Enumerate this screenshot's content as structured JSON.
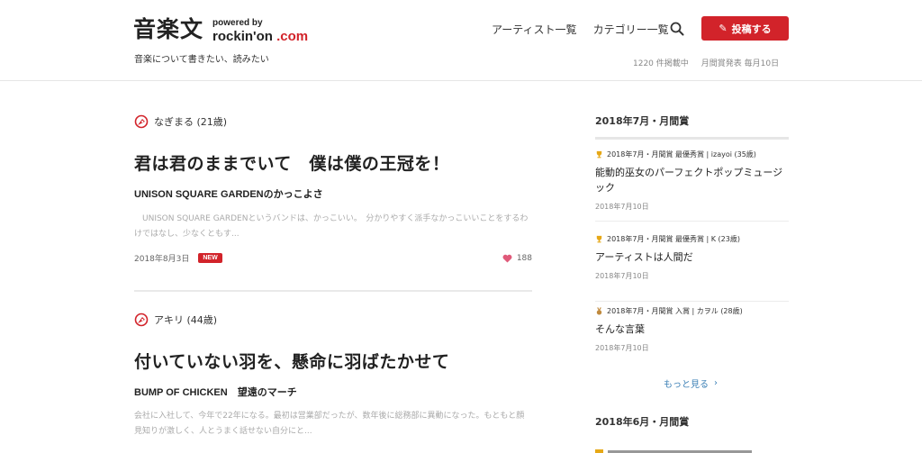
{
  "header": {
    "logo_main": "音楽文",
    "powered_by": "powered by",
    "rockinon": "rockin'on",
    "dotcom": ".com",
    "tagline": "音楽について書きたい、読みたい",
    "nav": [
      "アーティスト一覧",
      "カテゴリー一覧"
    ],
    "post_button": "投稿する",
    "meta_count": "1220 件掲載中",
    "meta_award": "月間賞発表 毎月10日"
  },
  "articles": [
    {
      "author": "なぎまる (21歳)",
      "title": "君は君のままでいて　僕は僕の王冠を！",
      "subtitle": "UNISON SQUARE GARDENのかっこよさ",
      "excerpt": "　UNISON SQUARE GARDENというバンドは、かっこいい。　分かりやすく派手なかっこいいことをするわけではなし、少なくともす...",
      "date": "2018年8月3日",
      "badge": "NEW",
      "likes": "188"
    },
    {
      "author": "アキリ (44歳)",
      "title": "付いていない羽を、懸命に羽ばたかせて",
      "subtitle": "BUMP OF CHICKEN　望遠のマーチ",
      "excerpt": "会社に入社して、今年で22年になる。最初は営業部だったが、数年後に総務部に異動になった。もともと顔見知りが激しく、人とうまく話せない自分にと..."
    }
  ],
  "sidebar": {
    "heading_1": "2018年7月・月間賞",
    "awards": [
      {
        "line": "2018年7月・月間賞 最優秀賞 | izayoi (35歳)",
        "title": "能動的巫女のパーフェクトポップミュージック",
        "date": "2018年7月10日",
        "trophy_color": "#e6a817"
      },
      {
        "line": "2018年7月・月間賞 最優秀賞 | K (23歳)",
        "title": "アーティストは人間だ",
        "date": "2018年7月10日",
        "trophy_color": "#e6a817"
      },
      {
        "line": "2018年7月・月間賞 入賞 | カヲル (28歳)",
        "title": "そんな言葉",
        "date": "2018年7月10日",
        "trophy_color": "#c08a3e"
      }
    ],
    "more": "もっと見る",
    "heading_2": "2018年6月・月間賞"
  },
  "colors": {
    "accent": "#d2232a",
    "link": "#3a7fb5",
    "heart": "#e05a7a"
  }
}
